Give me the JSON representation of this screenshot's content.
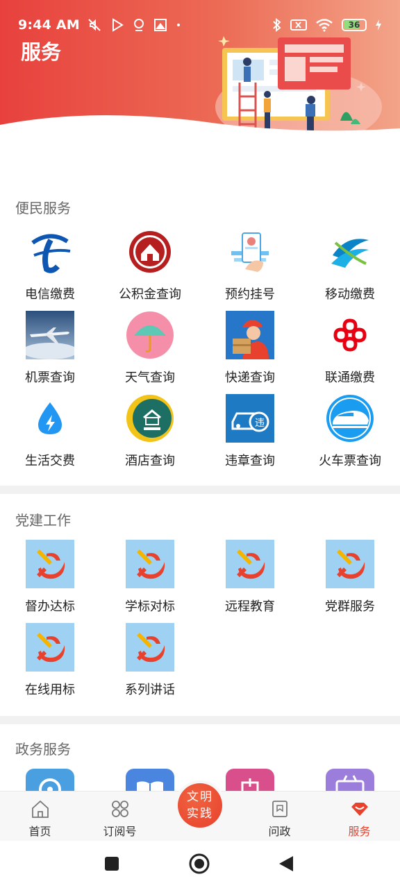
{
  "status_bar": {
    "time": "9:44 AM",
    "battery": "36"
  },
  "header": {
    "title": "服务"
  },
  "sections": [
    {
      "title": "便民服务",
      "items": [
        {
          "label": "电信缴费",
          "icon": "china-telecom-icon"
        },
        {
          "label": "公积金查询",
          "icon": "housing-fund-icon"
        },
        {
          "label": "预约挂号",
          "icon": "hospital-appointment-icon"
        },
        {
          "label": "移动缴费",
          "icon": "china-mobile-icon"
        },
        {
          "label": "机票查询",
          "icon": "airplane-icon"
        },
        {
          "label": "天气查询",
          "icon": "umbrella-icon"
        },
        {
          "label": "快递查询",
          "icon": "delivery-courier-icon"
        },
        {
          "label": "联通缴费",
          "icon": "china-unicom-icon"
        },
        {
          "label": "生活交费",
          "icon": "water-drop-bolt-icon"
        },
        {
          "label": "酒店查询",
          "icon": "hotel-icon"
        },
        {
          "label": "违章查询",
          "icon": "traffic-violation-icon"
        },
        {
          "label": "火车票查询",
          "icon": "high-speed-train-icon"
        }
      ]
    },
    {
      "title": "党建工作",
      "items": [
        {
          "label": "督办达标",
          "icon": "party-emblem-icon"
        },
        {
          "label": "学标对标",
          "icon": "party-emblem-icon"
        },
        {
          "label": "远程教育",
          "icon": "party-emblem-icon"
        },
        {
          "label": "党群服务",
          "icon": "party-emblem-icon"
        },
        {
          "label": "在线用标",
          "icon": "party-emblem-icon"
        },
        {
          "label": "系列讲话",
          "icon": "party-emblem-icon"
        }
      ]
    },
    {
      "title": "政务服务",
      "items": [
        {
          "label": "",
          "icon": "gov-blue-icon"
        },
        {
          "label": "",
          "icon": "book-icon"
        },
        {
          "label": "",
          "icon": "gov-pink-icon"
        },
        {
          "label": "",
          "icon": "gov-purple-icon"
        }
      ]
    }
  ],
  "bottom_nav": {
    "items": [
      {
        "label": "首页",
        "icon": "home-icon"
      },
      {
        "label": "订阅号",
        "icon": "subscription-icon"
      },
      {
        "label": "问政",
        "icon": "inquiry-icon"
      },
      {
        "label": "服务",
        "icon": "service-icon",
        "active": true
      }
    ],
    "center": {
      "label_line1": "文明",
      "label_line2": "实践"
    }
  },
  "colors": {
    "brand_red": "#e8412d",
    "header_gradient_start": "#e8413d",
    "header_gradient_end": "#f3a489",
    "active_nav": "#e8412d"
  }
}
